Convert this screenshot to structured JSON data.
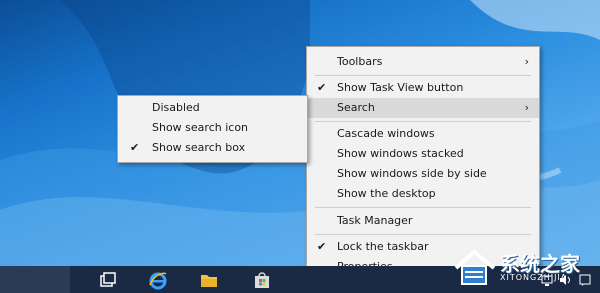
{
  "context_menu": {
    "items": [
      {
        "label": "Toolbars",
        "checked": false,
        "submenu": true
      },
      {
        "label": "Show Task View button",
        "checked": true,
        "submenu": false
      },
      {
        "label": "Search",
        "checked": false,
        "submenu": true,
        "highlighted": true
      },
      {
        "label": "Cascade windows",
        "checked": false,
        "submenu": false
      },
      {
        "label": "Show windows stacked",
        "checked": false,
        "submenu": false
      },
      {
        "label": "Show windows side by side",
        "checked": false,
        "submenu": false
      },
      {
        "label": "Show the desktop",
        "checked": false,
        "submenu": false
      },
      {
        "label": "Task Manager",
        "checked": false,
        "submenu": false
      },
      {
        "label": "Lock the taskbar",
        "checked": true,
        "submenu": false
      },
      {
        "label": "Properties",
        "checked": false,
        "submenu": false
      }
    ],
    "check_glyph": "✔",
    "arrow_glyph": "›"
  },
  "search_submenu": {
    "items": [
      {
        "label": "Disabled",
        "checked": false
      },
      {
        "label": "Show search icon",
        "checked": false
      },
      {
        "label": "Show search box",
        "checked": true
      }
    ]
  },
  "taskbar": {
    "icons": [
      "task-view-icon",
      "internet-explorer-icon",
      "file-explorer-icon",
      "store-icon"
    ],
    "tray_icons": [
      "network-icon",
      "volume-icon",
      "notification-icon"
    ]
  },
  "watermark": {
    "title": "系统之家",
    "subtitle": "XITONGZHIJIA"
  },
  "colors": {
    "menu_bg": "#f2f2f2",
    "menu_highlight": "#d9d9d9",
    "taskbar_bg": "#1b2a44"
  }
}
